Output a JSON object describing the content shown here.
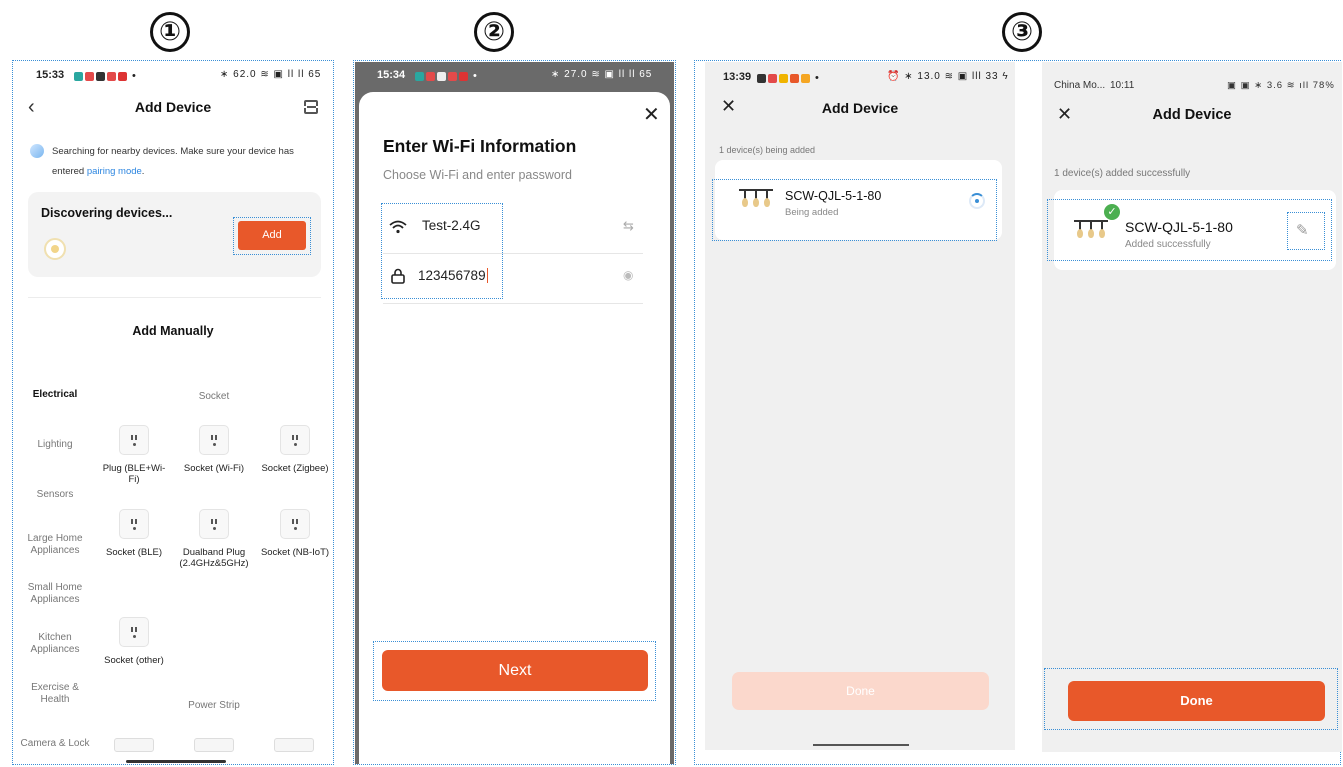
{
  "steps": {
    "one": "①",
    "two": "②",
    "three": "③"
  },
  "colors": {
    "accent": "#e8582a",
    "highlight_border": "#3a8fd6",
    "success": "#4caf50"
  },
  "screen1": {
    "time": "15:33",
    "status_icons": "∗ 62.0 ≋ ▣ ll ll 65",
    "title": "Add Device",
    "back_icon": "chevron-left-icon",
    "scan_icon": "scan-icon",
    "search_text": "Searching for nearby devices. Make sure your device has entered",
    "pairing_link": "pairing mode",
    "search_text_end": ".",
    "discover_label": "Discovering devices...",
    "add_label": "Add",
    "manual_title": "Add Manually",
    "sidebar": [
      "Electrical",
      "Lighting",
      "Sensors",
      "Large Home Appliances",
      "Small Home Appliances",
      "Kitchen Appliances",
      "Exercise & Health",
      "Camera & Lock"
    ],
    "section_socket": "Socket",
    "section_power_strip": "Power Strip",
    "products": [
      "Plug (BLE+Wi-Fi)",
      "Socket (Wi-Fi)",
      "Socket (Zigbee)",
      "Socket (BLE)",
      "Dualband Plug (2.4GHz&5GHz)",
      "Socket (NB-IoT)",
      "Socket (other)"
    ]
  },
  "screen2": {
    "time": "15:34",
    "status_icons": "∗ 27.0 ≋ ▣ ll ll 65",
    "close_icon": "close-icon",
    "heading": "Enter Wi-Fi Information",
    "subheading": "Choose Wi-Fi and enter password",
    "ssid": "Test-2.4G",
    "password": "123456789",
    "wifi_icon": "wifi-icon",
    "lock_icon": "lock-icon",
    "switch_icon": "switch-network-icon",
    "eye_icon": "show-password-icon",
    "next_label": "Next"
  },
  "screen3": {
    "time": "13:39",
    "status_icons": "⏰ ∗ 13.0 ≋ ▣ lll 33 ϟ",
    "title": "Add Device",
    "status_text": "1 device(s) being added",
    "device_name": "SCW-QJL-5-1-80",
    "device_status": "Being added",
    "button_label": "Done"
  },
  "screen4": {
    "carrier": "China Mo...",
    "time": "10:11",
    "status_icons": "▣ ▣ ∗ 3.6 ≋ ıll 78%",
    "title": "Add Device",
    "status_text": "1 device(s) added successfully",
    "device_name": "SCW-QJL-5-1-80",
    "device_status": "Added successfully",
    "edit_icon": "edit-icon",
    "done_label": "Done"
  }
}
